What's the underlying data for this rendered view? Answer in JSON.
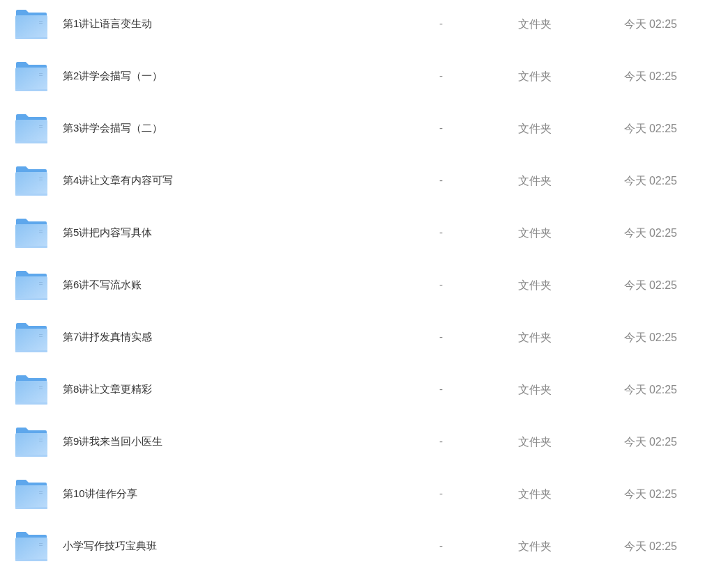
{
  "files": [
    {
      "name": "第1讲让语言变生动",
      "size": "-",
      "type": "文件夹",
      "modified": "今天 02:25"
    },
    {
      "name": "第2讲学会描写（一）",
      "size": "-",
      "type": "文件夹",
      "modified": "今天 02:25"
    },
    {
      "name": "第3讲学会描写（二）",
      "size": "-",
      "type": "文件夹",
      "modified": "今天 02:25"
    },
    {
      "name": "第4讲让文章有内容可写",
      "size": "-",
      "type": "文件夹",
      "modified": "今天 02:25"
    },
    {
      "name": "第5讲把内容写具体",
      "size": "-",
      "type": "文件夹",
      "modified": "今天 02:25"
    },
    {
      "name": "第6讲不写流水账",
      "size": "-",
      "type": "文件夹",
      "modified": "今天 02:25"
    },
    {
      "name": "第7讲抒发真情实感",
      "size": "-",
      "type": "文件夹",
      "modified": "今天 02:25"
    },
    {
      "name": "第8讲让文章更精彩",
      "size": "-",
      "type": "文件夹",
      "modified": "今天 02:25"
    },
    {
      "name": "第9讲我来当回小医生",
      "size": "-",
      "type": "文件夹",
      "modified": "今天 02:25"
    },
    {
      "name": "第10讲佳作分享",
      "size": "-",
      "type": "文件夹",
      "modified": "今天 02:25"
    },
    {
      "name": "小学写作技巧宝典班",
      "size": "-",
      "type": "文件夹",
      "modified": "今天 02:25"
    }
  ]
}
